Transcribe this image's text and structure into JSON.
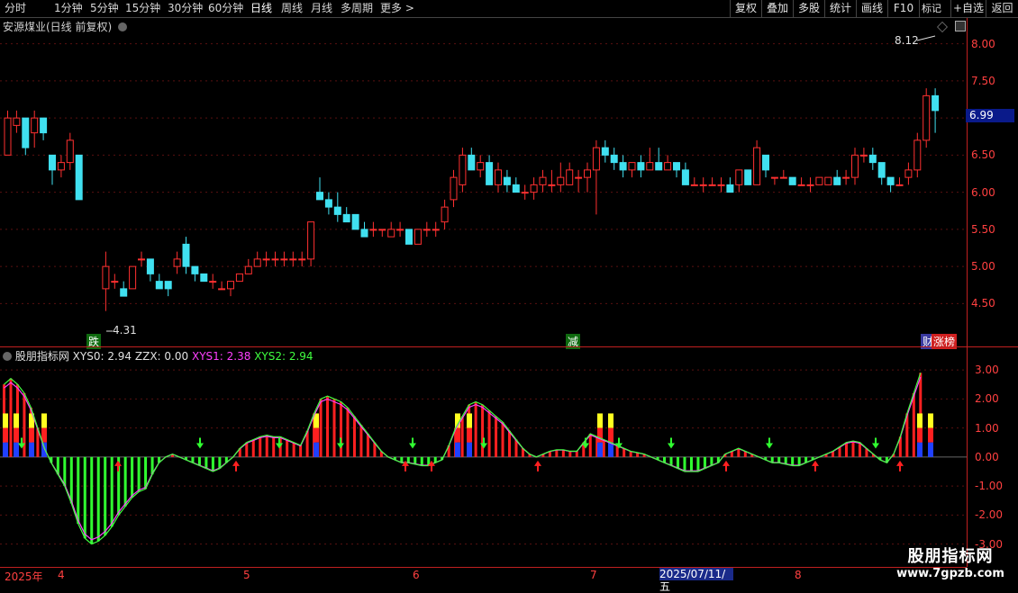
{
  "toolbar": {
    "periods": [
      "分时",
      "1分钟",
      "5分钟",
      "15分钟",
      "30分钟",
      "60分钟",
      "日线",
      "周线",
      "月线",
      "多周期",
      "更多 >"
    ],
    "active_period": "日线",
    "right_buttons": [
      "复权",
      "叠加",
      "多股",
      "统计",
      "画线",
      "F10",
      "+自选",
      "返回"
    ],
    "mark_label": "标记"
  },
  "stock": {
    "title": "安源煤业(日线 前复权)",
    "high_label": "8.12",
    "low_label": "4.31",
    "current_price": "6.99"
  },
  "price_axis": [
    "8.00",
    "7.50",
    "7.00",
    "6.50",
    "6.00",
    "5.50",
    "5.00",
    "4.50"
  ],
  "event_tags": {
    "fall": "跌",
    "reduce": "减",
    "fin": "财",
    "rank": "涨榜"
  },
  "indicator": {
    "name": "股朋指标网",
    "values": [
      {
        "label": "XYS0: 2.94",
        "color": "#e0e0e0"
      },
      {
        "label": "ZZX: 0.00",
        "color": "#e0e0e0"
      },
      {
        "label": "XYS1: 2.38",
        "color": "#ff40ff"
      },
      {
        "label": "XYS2: 2.94",
        "color": "#40ff40"
      }
    ],
    "axis": [
      "3.00",
      "2.00",
      "1.00",
      "0.00",
      "-1.00",
      "-2.00",
      "-3.00"
    ]
  },
  "dates": {
    "year": "2025年",
    "months": [
      "4",
      "5",
      "6",
      "7",
      "8"
    ],
    "highlight": "2025/07/11/五"
  },
  "watermark": {
    "title": "股朋指标网",
    "url": "www.7gpzb.com"
  },
  "colors": {
    "up": "#ff3030",
    "down": "#40e0f0",
    "green": "#20ff20",
    "grid": "#8b1a1a"
  }
}
